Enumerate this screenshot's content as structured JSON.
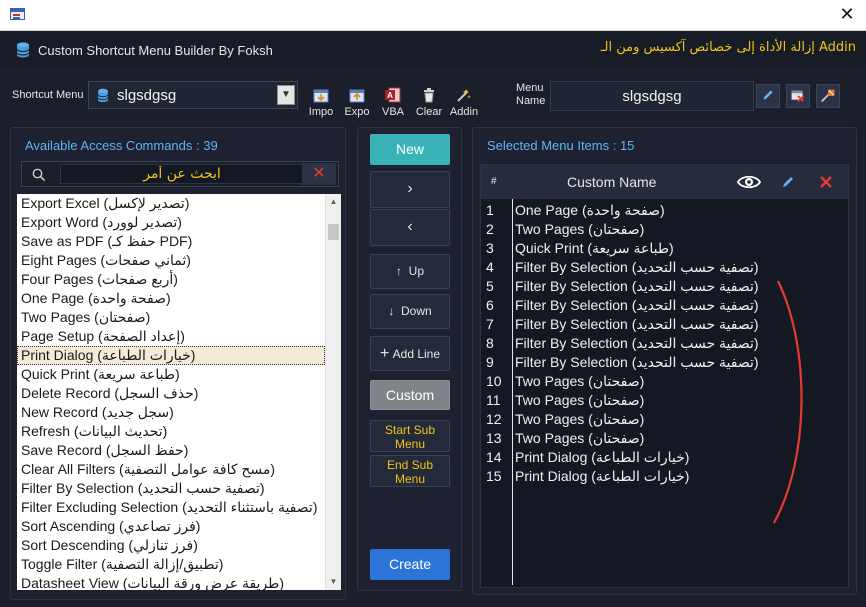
{
  "window": {
    "close_glyph": "✕"
  },
  "header": {
    "title": "Custom Shortcut Menu Builder By Foksh",
    "remove_link": "إزالة الأداة إلى خصائص آكسيس ومن الـ Addin"
  },
  "shortcut_menu": {
    "label": "Shortcut Menu",
    "value": "slgsdgsg",
    "arrow": "▼"
  },
  "toolbar": [
    {
      "label": "Impo",
      "icon": "import-icon"
    },
    {
      "label": "Expo",
      "icon": "export-icon"
    },
    {
      "label": "VBA",
      "icon": "access-vba-icon"
    },
    {
      "label": "Clear",
      "icon": "trash-icon"
    },
    {
      "label": "Addin",
      "icon": "addin-icon"
    }
  ],
  "menu_name": {
    "label_line1": "Menu",
    "label_line2": "Name",
    "value": "slgsdgsg"
  },
  "available": {
    "heading": "Available Access Commands : 39",
    "search_placeholder": "ابحث عن أمر",
    "clear_glyph": "✕",
    "selected_index": 8,
    "items": [
      "Export Excel (تصدير لإكسل)",
      "Export Word (تصدير لوورد)",
      "Save as PDF (حفظ كـ PDF)",
      "Eight Pages (ثماني صفحات)",
      "Four Pages (أربع صفحات)",
      "One Page (صفحة واحدة)",
      "Two Pages (صفحتان)",
      "Page Setup (إعداد الصفحة)",
      "Print Dialog (خيارات الطباعة)",
      "Quick Print (طباعة سريعة)",
      "Delete Record (حذف السجل)",
      "New Record (سجل جديد)",
      "Refresh (تحديث البيانات)",
      "Save Record (حفظ السجل)",
      "Clear All Filters (مسح كافة عوامل التصفية)",
      "Filter By Selection (تصفية حسب التحديد)",
      "Filter Excluding Selection (تصفية باستثناء التحديد)",
      "Sort Ascending (فرز تصاعدي)",
      "Sort Descending (فرز تنازلي)",
      "Toggle Filter (تطبيق/إزالة التصفية)",
      "Datasheet View (طريقة عرض ورقة البيانات)"
    ]
  },
  "middle": {
    "new": "New",
    "move_right": "›",
    "move_left": "‹",
    "up": "Up",
    "down": "Down",
    "add_line": "Add Line",
    "custom": "Custom",
    "start_sub_1": "Start Sub",
    "start_sub_2": "Menu",
    "end_sub_1": "End Sub",
    "end_sub_2": "Menu",
    "create": "Create"
  },
  "selected": {
    "heading": "Selected Menu Items : 15",
    "col_num": "#",
    "col_name": "Custom Name",
    "rows": [
      {
        "num": "1",
        "name": "One Page (صفحة واحدة)"
      },
      {
        "num": "2",
        "name": "Two Pages (صفحتان)"
      },
      {
        "num": "3",
        "name": "Quick Print (طباعة سريعة)"
      },
      {
        "num": "4",
        "name": "Filter By Selection (تصفية حسب التحديد)"
      },
      {
        "num": "5",
        "name": "Filter By Selection (تصفية حسب التحديد)"
      },
      {
        "num": "6",
        "name": "Filter By Selection (تصفية حسب التحديد)"
      },
      {
        "num": "7",
        "name": "Filter By Selection (تصفية حسب التحديد)"
      },
      {
        "num": "8",
        "name": "Filter By Selection (تصفية حسب التحديد)"
      },
      {
        "num": "9",
        "name": "Filter By Selection (تصفية حسب التحديد)"
      },
      {
        "num": "10",
        "name": "Two Pages (صفحتان)"
      },
      {
        "num": "11",
        "name": "Two Pages (صفحتان)"
      },
      {
        "num": "12",
        "name": "Two Pages (صفحتان)"
      },
      {
        "num": "13",
        "name": "Two Pages (صفحتان)"
      },
      {
        "num": "14",
        "name": "Print Dialog (خيارات الطباعة)"
      },
      {
        "num": "15",
        "name": "Print Dialog (خيارات الطباعة)"
      }
    ]
  },
  "colors": {
    "background": "#1b1f2b",
    "accent_blue": "#5fb4f0",
    "accent_yellow": "#f0c419",
    "new_button": "#3ab3b8",
    "create_button": "#2d74d8",
    "danger": "#e53935"
  }
}
